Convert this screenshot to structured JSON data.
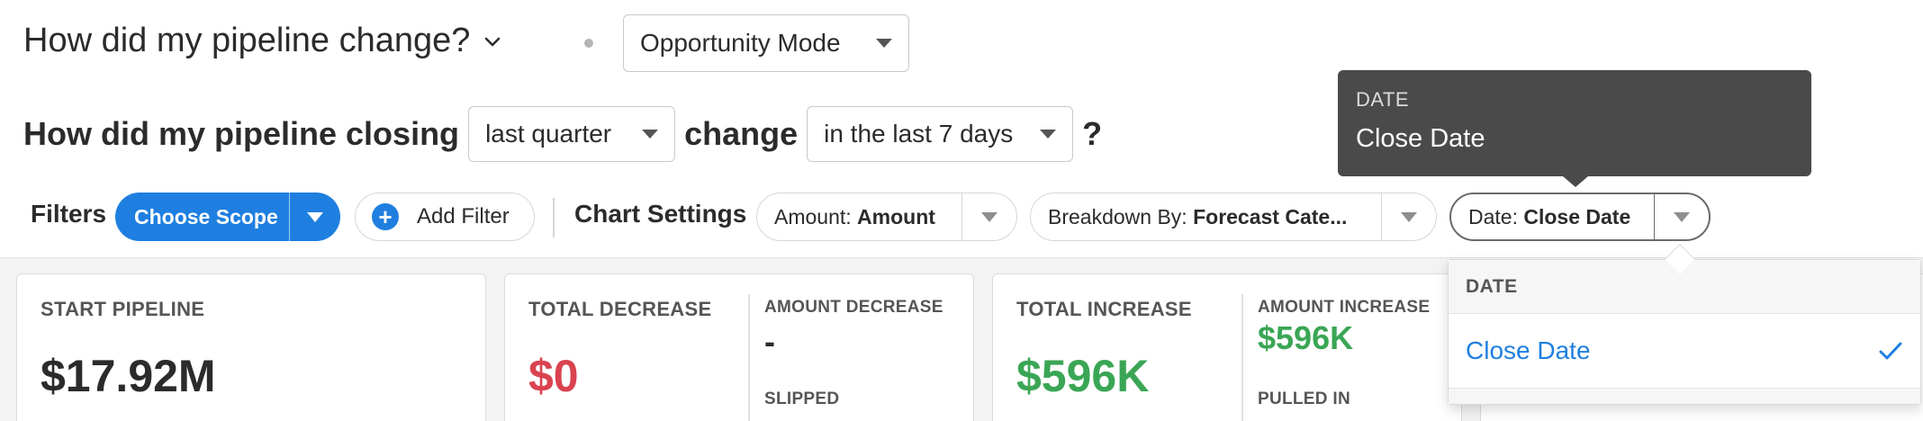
{
  "header": {
    "title": "How did my pipeline change?",
    "mode_select": "Opportunity Mode"
  },
  "question": {
    "part1": "How did my pipeline closing",
    "period_select": "last quarter",
    "part2": "change",
    "range_select": "in the last 7 days",
    "suffix": "?"
  },
  "filters": {
    "label": "Filters",
    "scope_button": "Choose Scope",
    "add_filter": "Add Filter"
  },
  "chart_settings": {
    "label": "Chart Settings",
    "amount": {
      "prefix": "Amount:",
      "value": "Amount"
    },
    "breakdown": {
      "prefix": "Breakdown By:",
      "value": "Forecast Cate..."
    },
    "date": {
      "prefix": "Date:",
      "value": "Close Date"
    }
  },
  "tooltip": {
    "heading": "DATE",
    "value": "Close Date"
  },
  "dropdown": {
    "heading": "DATE",
    "options": [
      {
        "label": "Close Date",
        "selected": true
      }
    ]
  },
  "cards": {
    "start": {
      "title": "START PIPELINE",
      "value": "$17.92M"
    },
    "decrease": {
      "title": "TOTAL DECREASE",
      "value": "$0",
      "sub1_title": "AMOUNT DECREASE",
      "sub1_value": "-",
      "sub2_title": "SLIPPED"
    },
    "increase": {
      "title": "TOTAL INCREASE",
      "value": "$596K",
      "sub1_title": "AMOUNT INCREASE",
      "sub1_value": "$596K",
      "sub2_title": "PULLED IN"
    }
  },
  "colors": {
    "accent": "#1f7fe0",
    "negative": "#d9434f",
    "positive": "#3aa655",
    "tooltip_bg": "#4a4a4a"
  }
}
